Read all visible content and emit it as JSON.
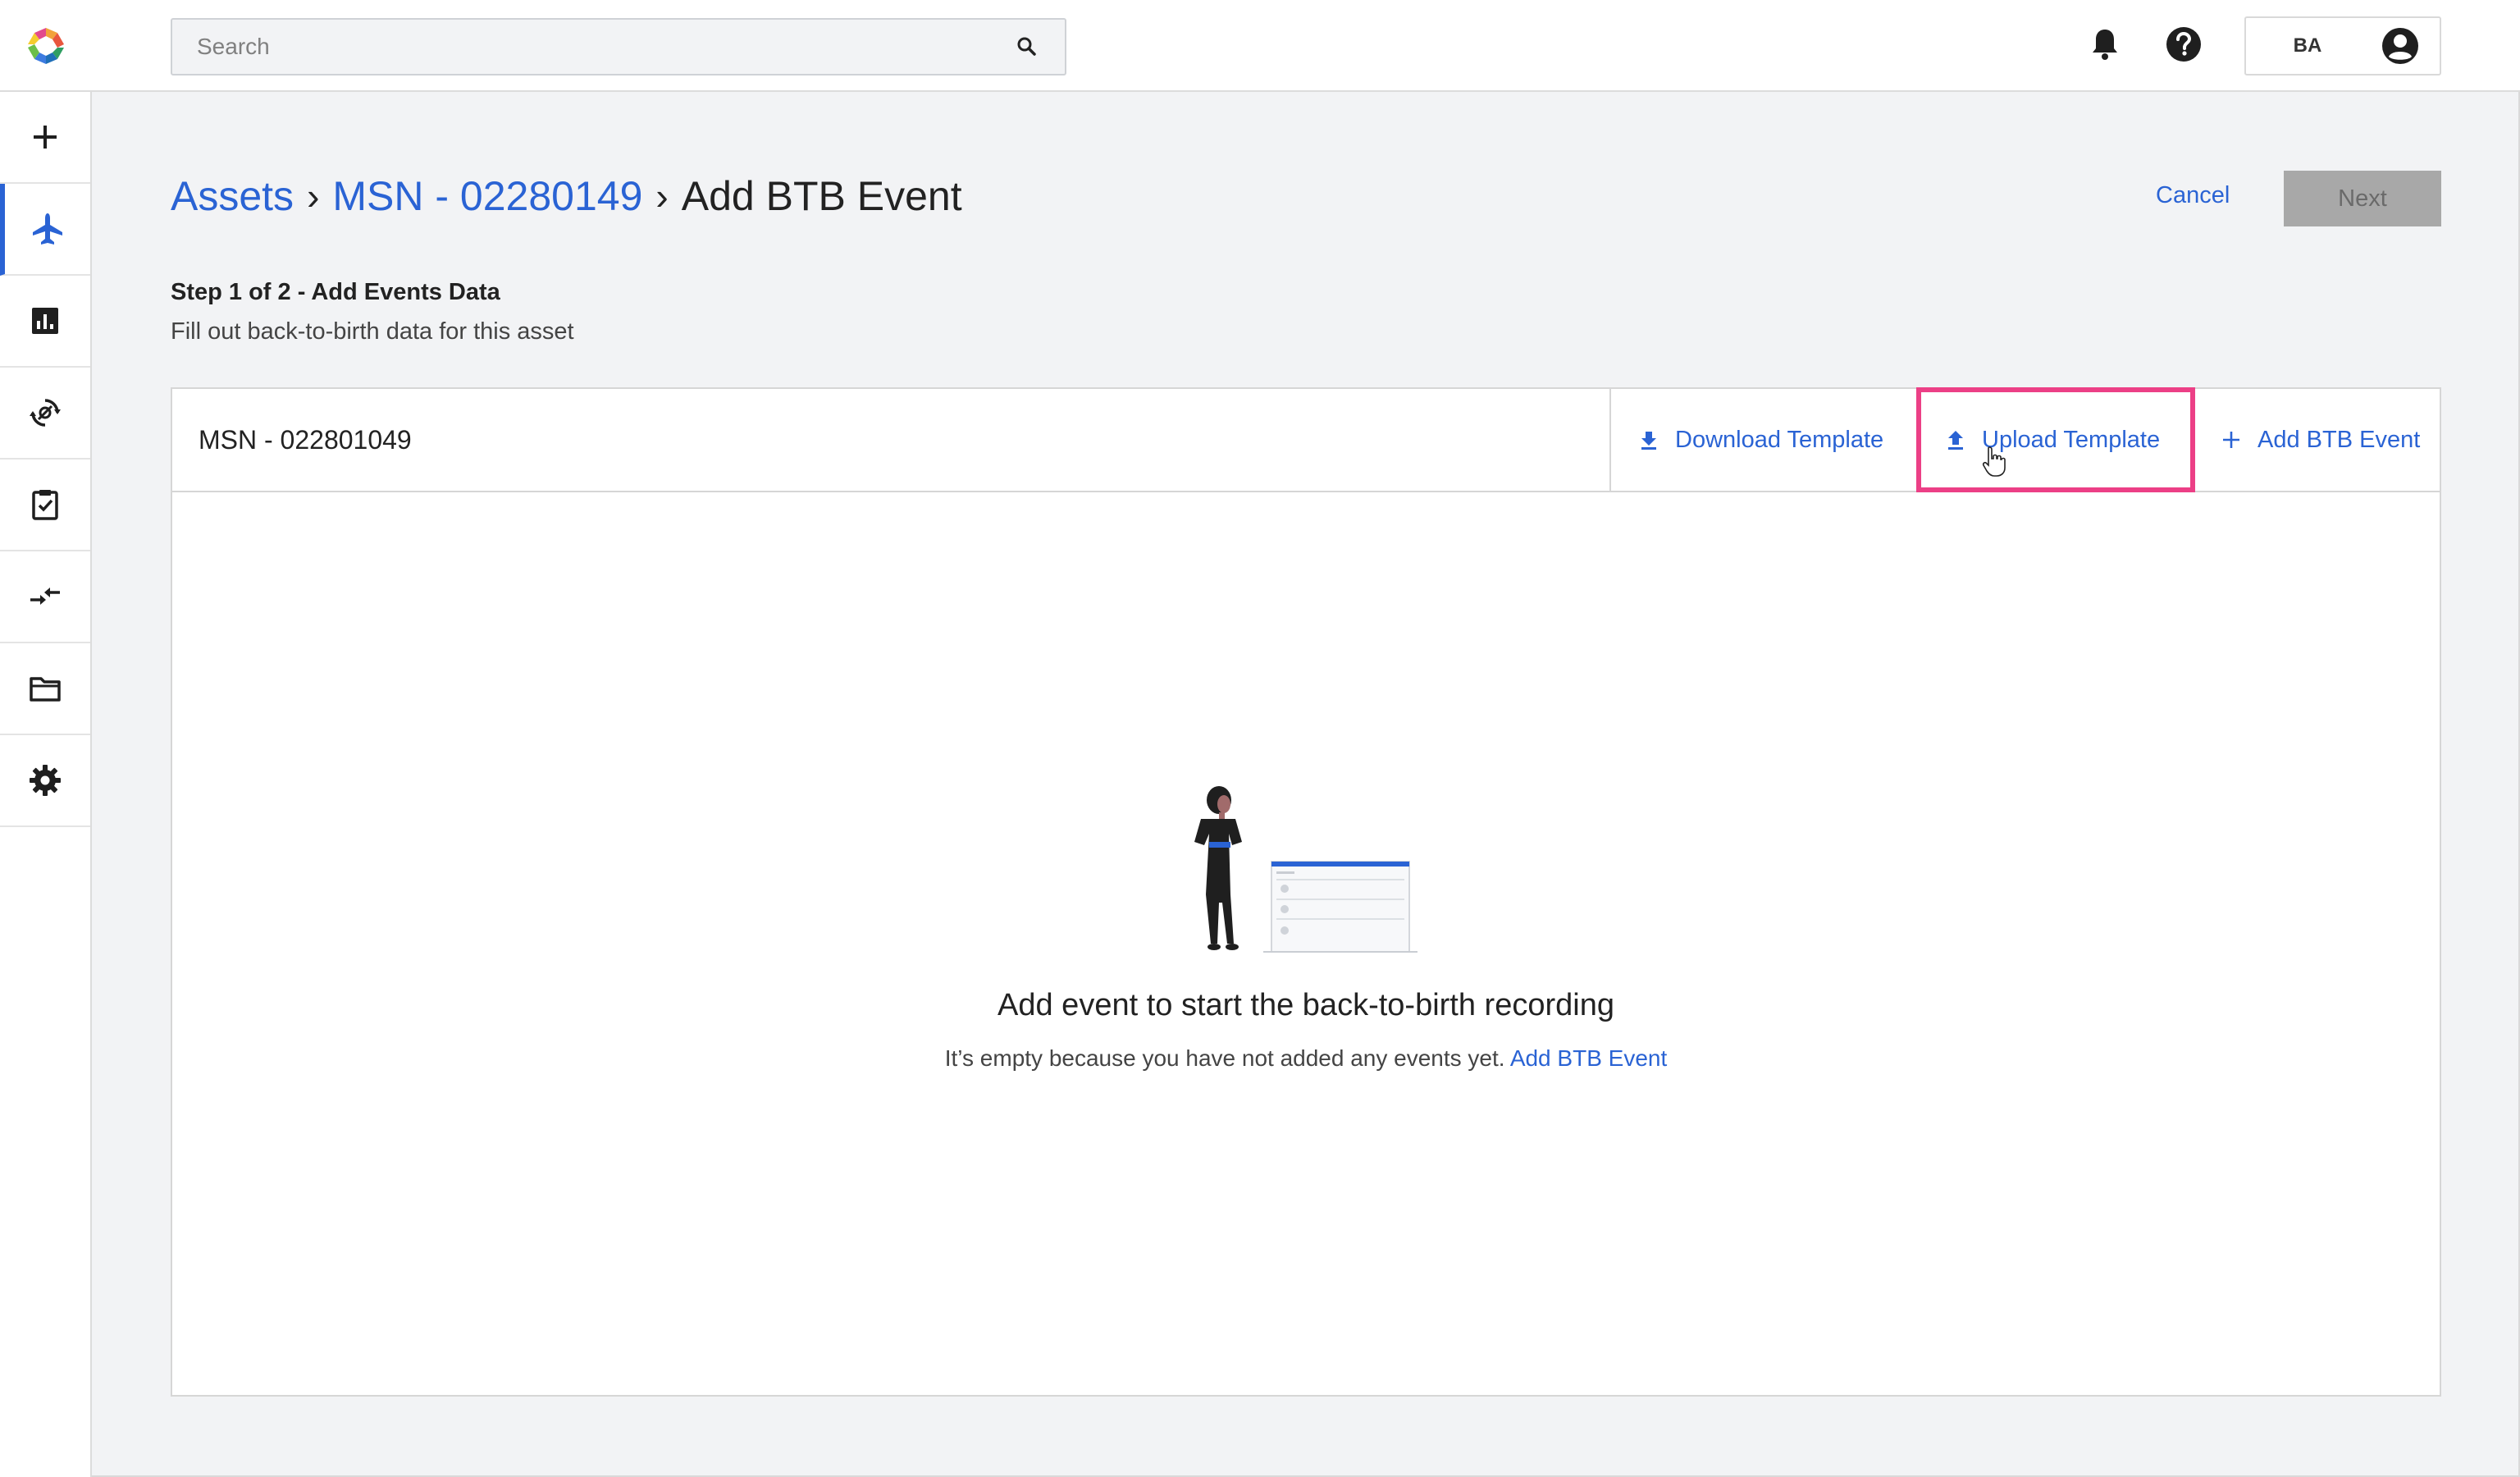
{
  "search": {
    "placeholder": "Search"
  },
  "user": {
    "initials": "BA"
  },
  "icons": {
    "logo": "app-logo",
    "search": "search-icon",
    "notifications": "bell-icon",
    "help": "help-icon",
    "account": "account-circle-icon"
  },
  "sidebar": {
    "items": [
      {
        "name": "add",
        "icon": "plus-icon"
      },
      {
        "name": "assets",
        "icon": "airplane-icon",
        "active": true
      },
      {
        "name": "reports",
        "icon": "bar-chart-icon"
      },
      {
        "name": "tracking",
        "icon": "sync-icon"
      },
      {
        "name": "tasks",
        "icon": "clipboard-check-icon"
      },
      {
        "name": "transfer",
        "icon": "swap-arrows-icon"
      },
      {
        "name": "files",
        "icon": "folder-icon"
      },
      {
        "name": "settings",
        "icon": "gear-icon"
      }
    ]
  },
  "breadcrumb": {
    "items": [
      "Assets",
      "MSN - 02280149"
    ],
    "separator": "›",
    "current": "Add BTB Event"
  },
  "actions": {
    "cancel": "Cancel",
    "next": "Next"
  },
  "step": {
    "title": "Step 1 of 2 - Add Events Data",
    "subtitle": "Fill out back-to-birth data for this asset"
  },
  "panel": {
    "asset_name": "MSN - 022801049",
    "download_label": "Download Template",
    "upload_label": "Upload Template",
    "add_label": "Add BTB Event"
  },
  "empty": {
    "title": "Add event to start the back-to-birth recording",
    "message": "It’s empty because you have not added any events yet.",
    "link": "Add BTB Event"
  },
  "colors": {
    "accent": "#2a63d4",
    "highlight": "#ec3f86",
    "disabled_button": "#a8a8a8"
  }
}
